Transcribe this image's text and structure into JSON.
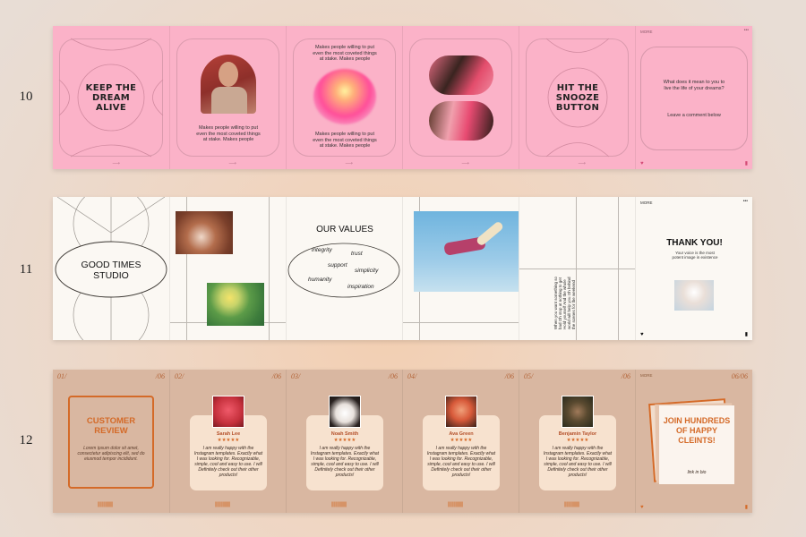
{
  "rows": [
    {
      "label": "10",
      "slides": [
        {
          "title": "KEEP THE DREAM ALIVE"
        },
        {
          "caption": "Makes people willing to put even the most coveted things at stake. Makes people"
        },
        {
          "text_top": "Makes people willing to put even the most coveted things at stake. Makes people",
          "text_bottom": "Makes people willing to put even the most coveted things at stake. Makes people"
        },
        {},
        {
          "title": "HIT THE SNOOZE BUTTON"
        },
        {
          "more": "MORE",
          "question": "What does it mean to you to live the life of your dreams?",
          "cta": "Leave a comment below"
        }
      ]
    },
    {
      "label": "11",
      "slides": [
        {
          "title": "GOOD TIMES STUDIO"
        },
        {},
        {
          "title": "OUR VALUES",
          "values": [
            "integrity",
            "trust",
            "support",
            "simplicity",
            "humanity",
            "inspiration"
          ]
        },
        {},
        {
          "vertical_text": "When you want something so bad Oh stop at nothing to get Hold yourself And the whole world will help you Oh behind the scenes for the weekend"
        },
        {
          "more": "MORE",
          "title": "THANK YOU!",
          "subtitle": "Your voice is the most potent image in existence"
        }
      ]
    },
    {
      "label": "12",
      "slides": [
        {
          "index": "01/",
          "total": "/06",
          "title": "CUSTOMER REVIEW",
          "body": "Lorem ipsum dolor sit amet, consectetur adipiscing elit, sed do eiusmod tempor incididunt."
        },
        {
          "index": "02/",
          "total": "/06",
          "name": "Sarah Lee",
          "stars": "★★★★★",
          "review": "I am really happy with the Instagram templates. Exactly what I was looking for. Recognizable, simple, cool and easy to use. I will Definitely check out their other products!"
        },
        {
          "index": "03/",
          "total": "/06",
          "name": "Noah Smith",
          "stars": "★★★★★",
          "review": "I am really happy with the Instagram templates. Exactly what I was looking for. Recognizable, simple, cool and easy to use. I will Definitely check out their other products!"
        },
        {
          "index": "04/",
          "total": "/06",
          "name": "Ava Green",
          "stars": "★★★★★",
          "review": "I am really happy with the Instagram templates. Exactly what I was looking for. Recognizable, simple, cool and easy to use. I will Definitely check out their other products!"
        },
        {
          "index": "05/",
          "total": "/06",
          "name": "Benjamin Taylor",
          "stars": "★★★★★",
          "review": "I am really happy with the Instagram templates. Exactly what I was looking for. Recognizable, simple, cool and easy to use. I will Definitely check out their other products!"
        },
        {
          "more": "MORE",
          "total": "06/06",
          "title": "JOIN HUNDREDS OF HAPPY CLEINTS!",
          "cta": "link in bio"
        }
      ]
    }
  ],
  "colors": {
    "pink": "#fbb2c8",
    "cream": "#fbf8f3",
    "tan": "#d9b7a1",
    "accent_orange": "#d46a28"
  },
  "icons": [
    "heart-icon",
    "bookmark-icon",
    "arrow-right-icon",
    "more-dots-icon"
  ]
}
